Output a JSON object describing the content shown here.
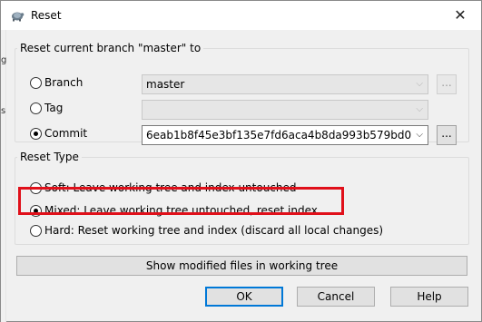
{
  "window": {
    "title": "Reset",
    "close_glyph": "✕",
    "icon": "tortoisegit-icon"
  },
  "branch_group": {
    "legend": "Reset current branch \"master\" to",
    "options": {
      "branch": {
        "label": "Branch",
        "selected": false,
        "value": "master",
        "enabled": false
      },
      "tag": {
        "label": "Tag",
        "selected": false,
        "value": "",
        "enabled": false
      },
      "commit": {
        "label": "Commit",
        "selected": true,
        "value": "6eab1b8f45e3bf135e7fd6aca4b8da993b579bd0",
        "enabled": true
      }
    },
    "browse_label": "..."
  },
  "reset_type": {
    "legend": "Reset Type",
    "soft": {
      "label": "Soft: Leave working tree and index untouched",
      "selected": false
    },
    "mixed": {
      "label": "Mixed: Leave working tree untouched, reset index",
      "selected": true
    },
    "hard": {
      "label": "Hard: Reset working tree and index (discard all local changes)",
      "selected": false
    }
  },
  "buttons": {
    "show_modified": "Show modified files in working tree",
    "ok": "OK",
    "cancel": "Cancel",
    "help": "Help"
  },
  "colors": {
    "highlight": "#e0101a",
    "dialog_bg": "#f0f0f0",
    "focus": "#0078d7"
  },
  "icons": {
    "combo": "chevron-down-icon"
  }
}
